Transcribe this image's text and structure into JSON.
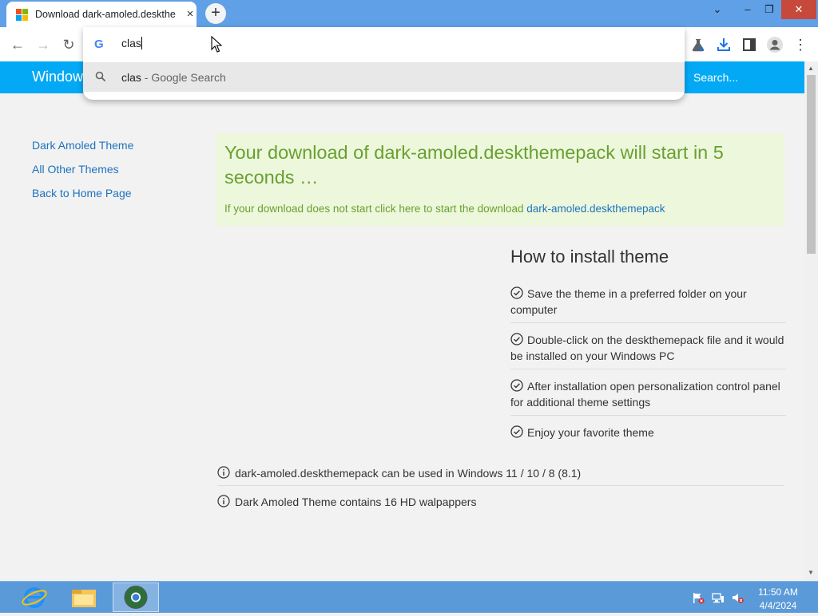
{
  "browser": {
    "tab": {
      "title": "Download dark-amoled.deskthe",
      "close_glyph": "×"
    },
    "new_tab_glyph": "+",
    "window_controls": {
      "chevron": "⌄",
      "minimize": "–",
      "restore": "❐",
      "close": "✕"
    },
    "nav": {
      "back": "←",
      "forward": "→",
      "reload": "↻"
    },
    "omnibox": {
      "provider_icon": "G",
      "input_value": "clas",
      "suggestion_query": "clas",
      "suggestion_desc": " - Google Search"
    },
    "toolbar_icons": [
      "labs-flask-icon",
      "download-icon",
      "side-panel-icon",
      "profile-icon",
      "kebab-menu-icon"
    ],
    "menu_glyph": "⋮"
  },
  "site": {
    "brand": "Window",
    "search_placeholder": "Search...",
    "sidebar": [
      {
        "label": "Dark Amoled Theme"
      },
      {
        "label": "All Other Themes"
      },
      {
        "label": "Back to Home Page"
      }
    ],
    "notice": {
      "title": "Your download of dark-amoled.deskthemepack will start in 5 seconds …",
      "subtitle_prefix": "If your download does not start click here to start the download ",
      "link_text": "dark-amoled.deskthemepack"
    },
    "install": {
      "heading": "How to install theme",
      "steps": [
        "Save the theme in a preferred folder on your computer",
        "Double-click on the deskthemepack file and it would be installed on your Windows PC",
        "After installation open personalization control panel for additional theme settings",
        "Enjoy your favorite theme"
      ]
    },
    "info": [
      "dark-amoled.deskthemepack can be used in Windows 11 / 10 / 8 (8.1)",
      "Dark Amoled Theme contains 16 HD walpappers"
    ]
  },
  "scrollbar": {
    "up": "▲",
    "down": "▼"
  },
  "taskbar": {
    "apps": [
      "internet-explorer-icon",
      "file-explorer-icon",
      "chrome-icon"
    ],
    "active_app": "chrome-icon",
    "tray_icons": [
      "action-center-flag-icon",
      "network-icon",
      "speaker-muted-icon"
    ],
    "time": "11:50 AM",
    "date": "4/4/2024"
  },
  "colors": {
    "tab_strip": "#5fa0e6",
    "site_header": "#03a9f4",
    "notice_bg": "#edf7dc",
    "notice_text": "#68a130",
    "link": "#1e73be",
    "taskbar": "#5b9ad8"
  }
}
